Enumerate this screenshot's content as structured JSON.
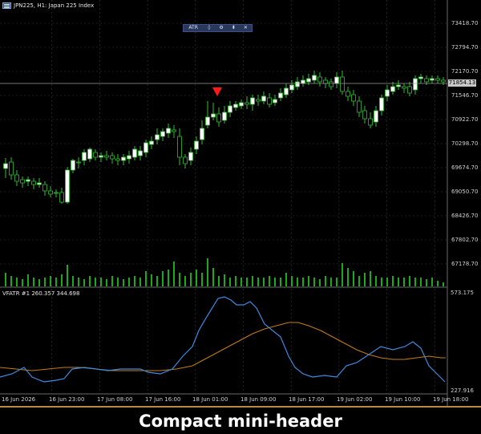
{
  "header": {
    "symbol_title": "JPN225, H1: Japan 225 Index"
  },
  "mini_header": {
    "indicator": "ATR",
    "buttons": [
      "◊",
      "⚙",
      "⬍",
      "✕"
    ]
  },
  "price_axis": {
    "ticks": [
      "73418.70",
      "72794.70",
      "72170.70",
      "71546.70",
      "70922.70",
      "70298.70",
      "69674.70",
      "69050.70",
      "68426.70",
      "67802.70",
      "67178.70"
    ],
    "current_price": "71854.13"
  },
  "indicator_panel": {
    "title": "VFATR #1 260.357 344.698",
    "axis_max": "573.175",
    "axis_min": "227.916",
    "line1_color": "#3d8ae0",
    "line2_color": "#c47b16"
  },
  "time_axis": {
    "labels": [
      "16 Jun 2026",
      "16 Jun 23:00",
      "17 Jun 08:00",
      "17 Jun 16:00",
      "18 Jun 01:00",
      "18 Jun 09:00",
      "18 Jun 17:00",
      "19 Jun 02:00",
      "19 Jun 10:00",
      "19 Jun 18:00"
    ]
  },
  "colors": {
    "bull_candle": "#ffffff",
    "bear_candle": "#000000",
    "candle_outline": "#2fbf2f",
    "volume_bar": "#1fa81f",
    "signal_arrow": "#ff1a1a",
    "grid": "#3a3a3a"
  },
  "caption": "Compact mini-header"
}
